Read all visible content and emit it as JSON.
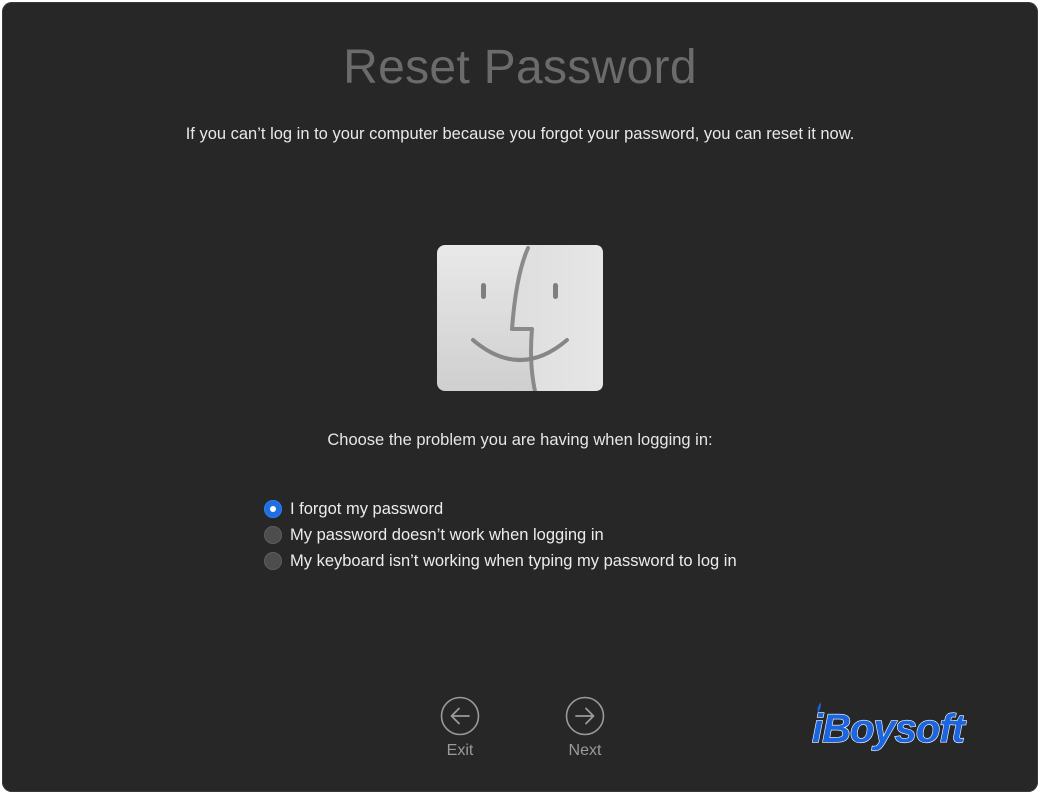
{
  "window": {
    "title": "Reset Password",
    "description": "If you can’t log in to your computer because you forgot your password, you can reset it now."
  },
  "icon": {
    "name": "finder-icon"
  },
  "problem": {
    "prompt": "Choose the problem you are having when logging in:",
    "options": [
      {
        "label": "I forgot my password",
        "selected": true
      },
      {
        "label": "My password doesn’t work when logging in",
        "selected": false
      },
      {
        "label": "My keyboard isn’t working when typing my password to log in",
        "selected": false
      }
    ]
  },
  "nav": {
    "exit_label": "Exit",
    "next_label": "Next"
  },
  "logo": {
    "text": "iBoysoft",
    "color": "#1b66e0"
  },
  "colors": {
    "background": "#272727",
    "accent": "#1f6fe0",
    "title": "#6b6b6b"
  }
}
